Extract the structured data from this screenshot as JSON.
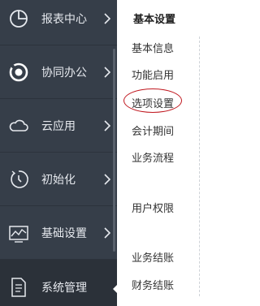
{
  "sidebar": {
    "items": [
      {
        "label": "报表中心",
        "icon": "pie-chart-icon"
      },
      {
        "label": "协同办公",
        "icon": "collaboration-icon"
      },
      {
        "label": "云应用",
        "icon": "cloud-icon"
      },
      {
        "label": "初始化",
        "icon": "refresh-clock-icon"
      },
      {
        "label": "基础设置",
        "icon": "settings-chart-icon"
      },
      {
        "label": "系统管理",
        "icon": "document-icon"
      }
    ]
  },
  "submenu": {
    "title": "基本设置",
    "items": [
      "基本信息",
      "功能启用",
      "选项设置",
      "会计期间",
      "业务流程",
      "用户权限",
      "业务结账",
      "财务结账"
    ]
  },
  "colors": {
    "sidebar_bg": "#363e49",
    "highlight_oval": "#c0181f"
  }
}
